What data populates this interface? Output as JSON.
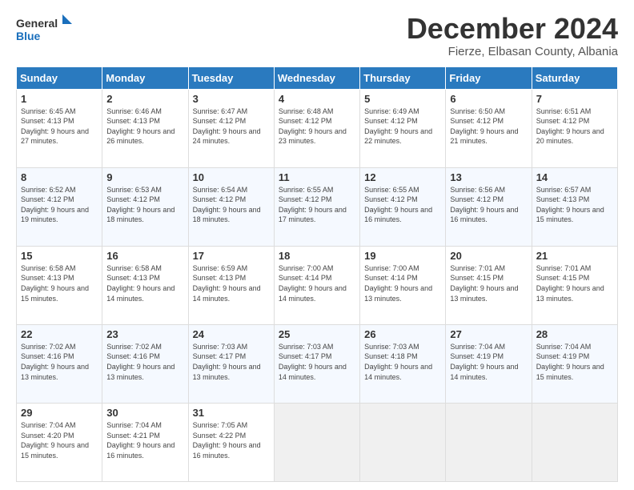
{
  "header": {
    "logo_line1": "General",
    "logo_line2": "Blue",
    "title": "December 2024",
    "subtitle": "Fierze, Elbasan County, Albania"
  },
  "days_of_week": [
    "Sunday",
    "Monday",
    "Tuesday",
    "Wednesday",
    "Thursday",
    "Friday",
    "Saturday"
  ],
  "weeks": [
    [
      {
        "day": "1",
        "sunrise": "6:45 AM",
        "sunset": "4:13 PM",
        "daylight": "9 hours and 27 minutes."
      },
      {
        "day": "2",
        "sunrise": "6:46 AM",
        "sunset": "4:13 PM",
        "daylight": "9 hours and 26 minutes."
      },
      {
        "day": "3",
        "sunrise": "6:47 AM",
        "sunset": "4:12 PM",
        "daylight": "9 hours and 24 minutes."
      },
      {
        "day": "4",
        "sunrise": "6:48 AM",
        "sunset": "4:12 PM",
        "daylight": "9 hours and 23 minutes."
      },
      {
        "day": "5",
        "sunrise": "6:49 AM",
        "sunset": "4:12 PM",
        "daylight": "9 hours and 22 minutes."
      },
      {
        "day": "6",
        "sunrise": "6:50 AM",
        "sunset": "4:12 PM",
        "daylight": "9 hours and 21 minutes."
      },
      {
        "day": "7",
        "sunrise": "6:51 AM",
        "sunset": "4:12 PM",
        "daylight": "9 hours and 20 minutes."
      }
    ],
    [
      {
        "day": "8",
        "sunrise": "6:52 AM",
        "sunset": "4:12 PM",
        "daylight": "9 hours and 19 minutes."
      },
      {
        "day": "9",
        "sunrise": "6:53 AM",
        "sunset": "4:12 PM",
        "daylight": "9 hours and 18 minutes."
      },
      {
        "day": "10",
        "sunrise": "6:54 AM",
        "sunset": "4:12 PM",
        "daylight": "9 hours and 18 minutes."
      },
      {
        "day": "11",
        "sunrise": "6:55 AM",
        "sunset": "4:12 PM",
        "daylight": "9 hours and 17 minutes."
      },
      {
        "day": "12",
        "sunrise": "6:55 AM",
        "sunset": "4:12 PM",
        "daylight": "9 hours and 16 minutes."
      },
      {
        "day": "13",
        "sunrise": "6:56 AM",
        "sunset": "4:12 PM",
        "daylight": "9 hours and 16 minutes."
      },
      {
        "day": "14",
        "sunrise": "6:57 AM",
        "sunset": "4:13 PM",
        "daylight": "9 hours and 15 minutes."
      }
    ],
    [
      {
        "day": "15",
        "sunrise": "6:58 AM",
        "sunset": "4:13 PM",
        "daylight": "9 hours and 15 minutes."
      },
      {
        "day": "16",
        "sunrise": "6:58 AM",
        "sunset": "4:13 PM",
        "daylight": "9 hours and 14 minutes."
      },
      {
        "day": "17",
        "sunrise": "6:59 AM",
        "sunset": "4:13 PM",
        "daylight": "9 hours and 14 minutes."
      },
      {
        "day": "18",
        "sunrise": "7:00 AM",
        "sunset": "4:14 PM",
        "daylight": "9 hours and 14 minutes."
      },
      {
        "day": "19",
        "sunrise": "7:00 AM",
        "sunset": "4:14 PM",
        "daylight": "9 hours and 13 minutes."
      },
      {
        "day": "20",
        "sunrise": "7:01 AM",
        "sunset": "4:15 PM",
        "daylight": "9 hours and 13 minutes."
      },
      {
        "day": "21",
        "sunrise": "7:01 AM",
        "sunset": "4:15 PM",
        "daylight": "9 hours and 13 minutes."
      }
    ],
    [
      {
        "day": "22",
        "sunrise": "7:02 AM",
        "sunset": "4:16 PM",
        "daylight": "9 hours and 13 minutes."
      },
      {
        "day": "23",
        "sunrise": "7:02 AM",
        "sunset": "4:16 PM",
        "daylight": "9 hours and 13 minutes."
      },
      {
        "day": "24",
        "sunrise": "7:03 AM",
        "sunset": "4:17 PM",
        "daylight": "9 hours and 13 minutes."
      },
      {
        "day": "25",
        "sunrise": "7:03 AM",
        "sunset": "4:17 PM",
        "daylight": "9 hours and 14 minutes."
      },
      {
        "day": "26",
        "sunrise": "7:03 AM",
        "sunset": "4:18 PM",
        "daylight": "9 hours and 14 minutes."
      },
      {
        "day": "27",
        "sunrise": "7:04 AM",
        "sunset": "4:19 PM",
        "daylight": "9 hours and 14 minutes."
      },
      {
        "day": "28",
        "sunrise": "7:04 AM",
        "sunset": "4:19 PM",
        "daylight": "9 hours and 15 minutes."
      }
    ],
    [
      {
        "day": "29",
        "sunrise": "7:04 AM",
        "sunset": "4:20 PM",
        "daylight": "9 hours and 15 minutes."
      },
      {
        "day": "30",
        "sunrise": "7:04 AM",
        "sunset": "4:21 PM",
        "daylight": "9 hours and 16 minutes."
      },
      {
        "day": "31",
        "sunrise": "7:05 AM",
        "sunset": "4:22 PM",
        "daylight": "9 hours and 16 minutes."
      },
      null,
      null,
      null,
      null
    ]
  ],
  "labels": {
    "sunrise": "Sunrise:",
    "sunset": "Sunset:",
    "daylight": "Daylight:"
  }
}
